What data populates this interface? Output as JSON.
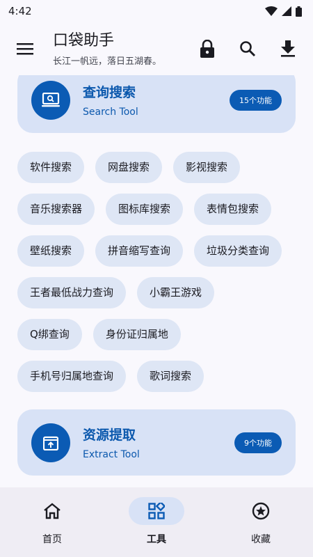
{
  "status": {
    "time": "4:42"
  },
  "app_bar": {
    "title": "口袋助手",
    "subtitle": "长江一帆远，落日五湖春。"
  },
  "cards": [
    {
      "title": "查询搜索",
      "subtitle": "Search Tool",
      "badge": "15个功能",
      "icon": "search-monitor-icon"
    },
    {
      "title": "资源提取",
      "subtitle": "Extract Tool",
      "badge": "9个功能",
      "icon": "upload-box-icon"
    }
  ],
  "chips": [
    [
      "软件搜索",
      "网盘搜索",
      "影视搜索"
    ],
    [
      "音乐搜索器",
      "图标库搜索",
      "表情包搜索"
    ],
    [
      "壁纸搜索",
      "拼音缩写查询",
      "垃圾分类查询"
    ],
    [
      "王者最低战力查询",
      "小霸王游戏"
    ],
    [
      "Q绑查询",
      "身份证归属地"
    ],
    [
      "手机号归属地查询",
      "歌词搜索"
    ]
  ],
  "nav": [
    {
      "label": "首页",
      "icon": "home-icon"
    },
    {
      "label": "工具",
      "icon": "apps-icon",
      "active": true
    },
    {
      "label": "收藏",
      "icon": "star-circle-icon"
    }
  ],
  "colors": {
    "accent": "#0b5bb4",
    "card_bg": "#d8e2f6",
    "chip_bg": "#dee6f5"
  }
}
